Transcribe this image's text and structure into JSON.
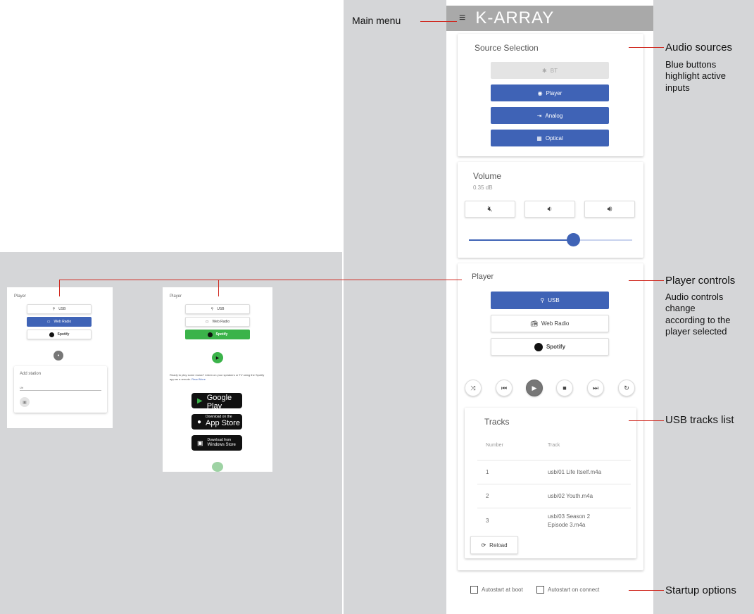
{
  "annotations": {
    "main_menu": "Main menu",
    "audio_sources": "Audio sources",
    "audio_sources_desc": [
      "Blue buttons",
      "highlight active",
      "inputs"
    ],
    "player_controls": "Player controls",
    "player_controls_desc": [
      "Audio controls",
      "change",
      "according to the",
      "player selected"
    ],
    "usb_tracks": "USB tracks list",
    "startup": "Startup options"
  },
  "header": {
    "logo": "K-ARRAY"
  },
  "source_selection": {
    "title": "Source Selection",
    "buttons": [
      {
        "label": "BT",
        "icon": "bluetooth-icon",
        "state": "disabled"
      },
      {
        "label": "Player",
        "icon": "player-icon",
        "state": "active"
      },
      {
        "label": "Analog",
        "icon": "analog-input-icon",
        "state": "active"
      },
      {
        "label": "Optical",
        "icon": "optical-icon",
        "state": "active"
      }
    ]
  },
  "volume": {
    "title": "Volume",
    "value": "0.35 dB",
    "buttons": [
      {
        "icon": "mute-icon"
      },
      {
        "icon": "volume-down-icon"
      },
      {
        "icon": "volume-up-icon"
      }
    ],
    "slider_level": 0.64
  },
  "player": {
    "title": "Player",
    "buttons": [
      {
        "label": "USB",
        "icon": "usb-icon",
        "state": "active"
      },
      {
        "label": "Web Radio",
        "icon": "radio-icon",
        "state": "inactive"
      },
      {
        "label": "Spotify",
        "icon": "spotify-icon",
        "state": "inactive"
      }
    ],
    "controls": [
      "shuffle-icon",
      "previous-icon",
      "play-icon",
      "stop-icon",
      "next-icon",
      "repeat-icon"
    ]
  },
  "tracks": {
    "title": "Tracks",
    "columns": [
      "Number",
      "Track"
    ],
    "rows": [
      {
        "number": "1",
        "track": "usb/01 Life Itself.m4a"
      },
      {
        "number": "2",
        "track": "usb/02 Youth.m4a"
      },
      {
        "number": "3",
        "track": "usb/03 Season 2 Episode 3.m4a"
      }
    ],
    "reload_label": "Reload"
  },
  "startup": {
    "autostart_boot": "Autostart at boot",
    "autostart_connect": "Autostart on connect"
  },
  "mini_webradio": {
    "title": "Player",
    "buttons": [
      {
        "label": "USB",
        "icon": "usb-icon"
      },
      {
        "label": "Web Radio",
        "icon": "radio-icon"
      },
      {
        "label": "Spotify",
        "icon": "spotify-icon"
      }
    ],
    "add_station": "Add station",
    "field_label": "Url"
  },
  "mini_spotify": {
    "title": "Player",
    "buttons": [
      {
        "label": "USB",
        "icon": "usb-icon"
      },
      {
        "label": "Web Radio",
        "icon": "radio-icon"
      },
      {
        "label": "Spotify",
        "icon": "spotify-icon"
      }
    ],
    "description": "Ready to play some music? Listen on your speakers or TV using the Spotify app as a remote.",
    "link": "Read More",
    "stores": [
      {
        "small": "GET IT ON",
        "big": "Google Play",
        "icon": "google-play-icon"
      },
      {
        "small": "Download on the",
        "big": "App Store",
        "icon": "apple-icon"
      },
      {
        "small": "Download from",
        "big": "Windows Store",
        "icon": "windows-icon"
      }
    ]
  },
  "colors": {
    "active_blue": "#3f63b6",
    "spotify_green": "#3bb34a",
    "annotation_red": "#d0281f"
  }
}
